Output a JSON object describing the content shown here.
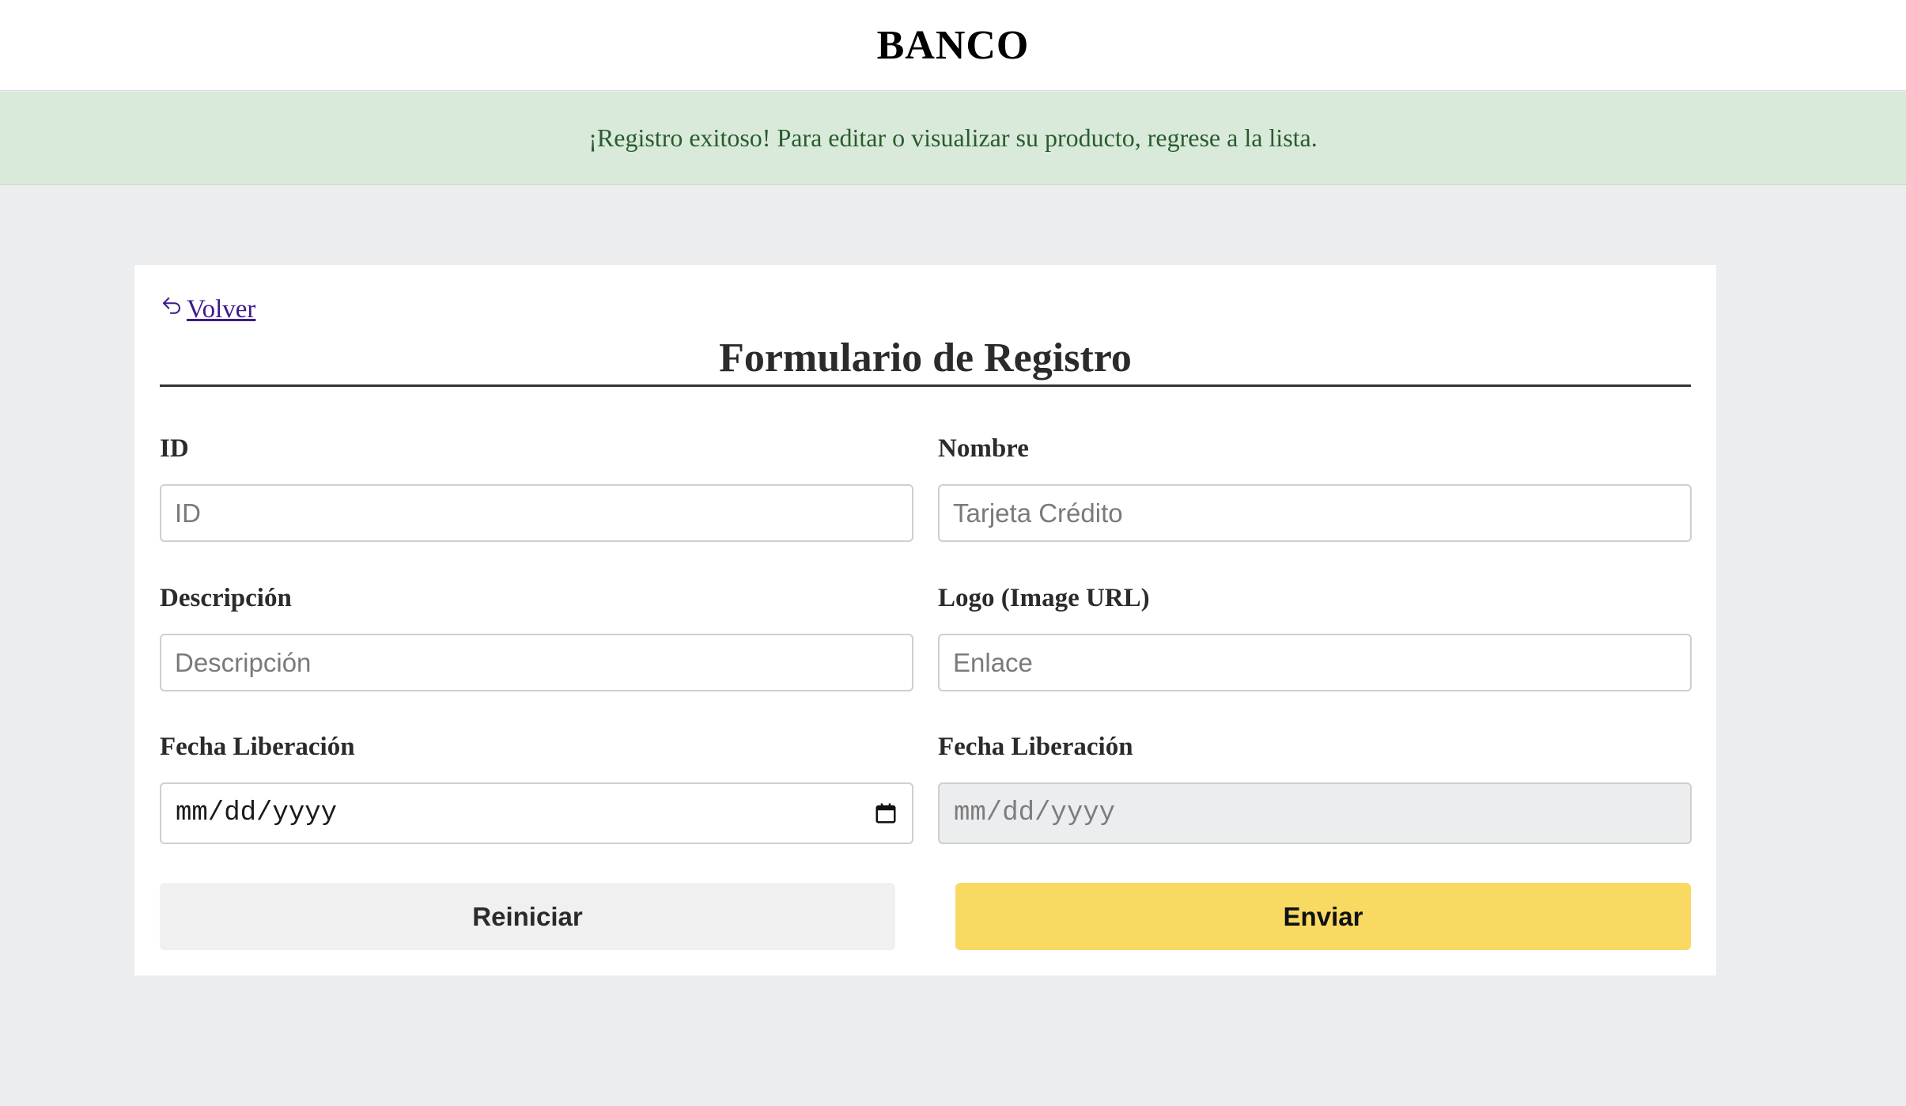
{
  "header": {
    "brand": "BANCO"
  },
  "alert": {
    "message": "¡Registro exitoso! Para editar o visualizar su producto, regrese a la lista."
  },
  "form": {
    "back_label": " Volver",
    "title": "Formulario de Registro",
    "fields": {
      "id": {
        "label": "ID",
        "value": "",
        "placeholder": "ID"
      },
      "name": {
        "label": "Nombre",
        "value": "",
        "placeholder": "Tarjeta Crédito"
      },
      "description": {
        "label": "Descripción",
        "value": "",
        "placeholder": "Descripción"
      },
      "logo": {
        "label": "Logo (Image URL)",
        "value": "",
        "placeholder": "Enlace"
      },
      "release_date": {
        "label": "Fecha Liberación",
        "value": "mm/dd/yyyy"
      },
      "review_date": {
        "label": "Fecha Liberación",
        "value": "mm/dd/yyyy",
        "disabled": true
      }
    },
    "buttons": {
      "reset_label": "Reiniciar",
      "submit_label": "Enviar"
    }
  },
  "colors": {
    "background": "#ecedef",
    "alert_bg": "#d9eadb",
    "alert_text": "#2a5b2e",
    "link": "#3d1a8a",
    "submit_bg": "#f8da63",
    "reset_bg": "#f0f0f0"
  },
  "icons": {
    "back": "undo-arrow-icon",
    "calendar": "calendar-icon"
  }
}
